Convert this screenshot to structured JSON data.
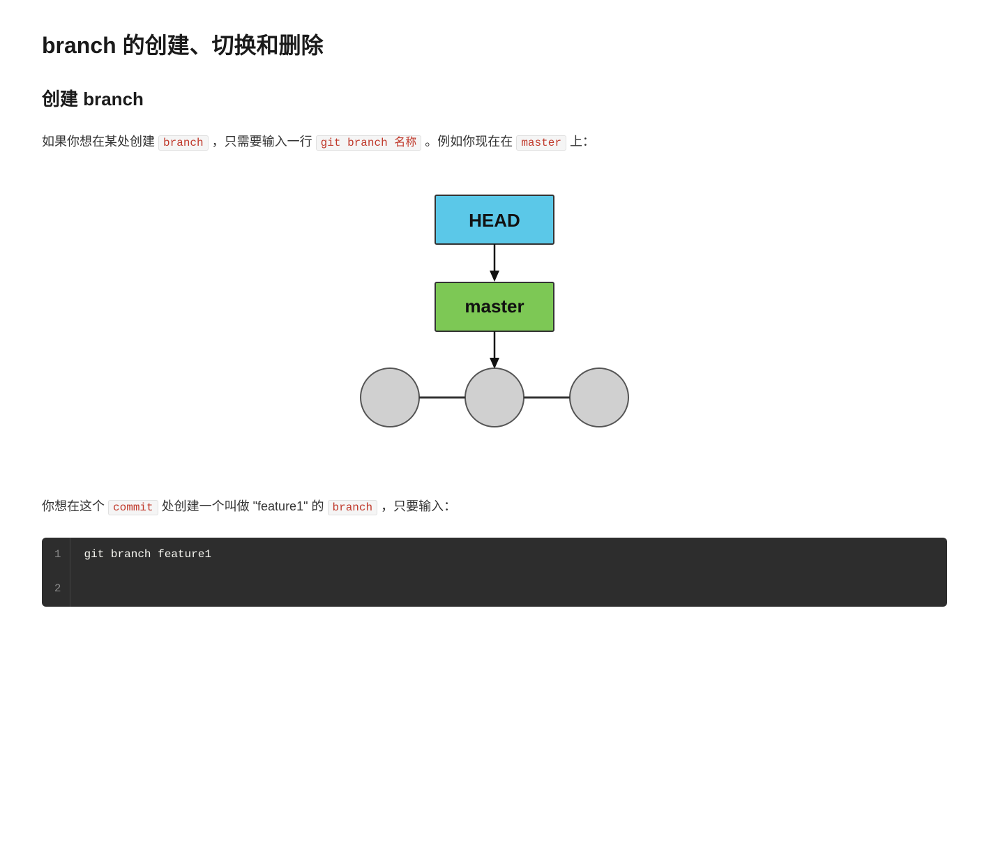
{
  "page": {
    "title": "branch 的创建、切换和删除",
    "section1": {
      "title": "创建 branch",
      "paragraph1": {
        "prefix": "如果你想在某处创建",
        "code1": "branch",
        "middle1": "，只需要输入一行",
        "code2": "git branch 名称",
        "middle2": "。例如你现在在",
        "code3": "master",
        "suffix": "上："
      },
      "paragraph2": {
        "prefix": "你想在这个",
        "code1": "commit",
        "middle1": "处创建一个叫做 \"feature1\" 的",
        "code2": "branch",
        "suffix": "，只要输入："
      }
    },
    "diagram": {
      "head_label": "HEAD",
      "master_label": "master",
      "head_color": "#5bc8e8",
      "master_color": "#7dc855"
    },
    "code_block": {
      "lines": [
        {
          "num": "1",
          "content": "git branch feature1"
        },
        {
          "num": "2",
          "content": ""
        }
      ]
    }
  }
}
